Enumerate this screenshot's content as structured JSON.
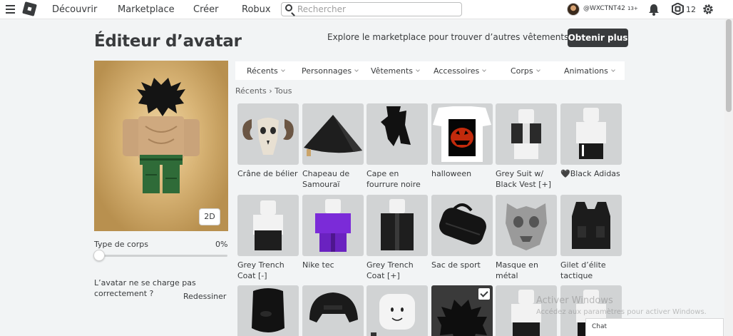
{
  "nav": {
    "discover": "Découvrir",
    "marketplace": "Marketplace",
    "create": "Créer",
    "robux": "Robux",
    "search_placeholder": "Rechercher",
    "username": "@WXCTNT42",
    "age_badge": "13+",
    "robux_balance": "12"
  },
  "header": {
    "title": "Éditeur d’avatar",
    "promo": "Explore le marketplace pour trouver d’autres vêtements !",
    "get_more": "Obtenir plus"
  },
  "preview": {
    "mode_button": "2D",
    "body_type_label": "Type de corps",
    "body_type_value": "0%",
    "body_type_fraction": 0,
    "load_message": "L’avatar ne se charge pas correctement ?",
    "redraw": "Redessiner"
  },
  "tabs": [
    {
      "label": "Récents"
    },
    {
      "label": "Personnages"
    },
    {
      "label": "Vêtements"
    },
    {
      "label": "Accessoires"
    },
    {
      "label": "Corps"
    },
    {
      "label": "Animations"
    }
  ],
  "breadcrumb": {
    "parent": "Récents",
    "separator": "›",
    "current": "Tous"
  },
  "items": [
    {
      "name": "Crâne de bélier",
      "icon": "ram-skull-icon"
    },
    {
      "name": "Chapeau de Samouraï",
      "icon": "samurai-hat-icon"
    },
    {
      "name": "Cape en fourrure noire",
      "icon": "black-fur-cape-icon"
    },
    {
      "name": "halloween",
      "icon": "halloween-shirt-icon"
    },
    {
      "name": "Grey Suit w/ Black Vest [+]",
      "icon": "grey-suit-icon"
    },
    {
      "name": "🖤Black Adidas",
      "icon": "black-adidas-icon"
    },
    {
      "name": "Grey Trench Coat [-]",
      "icon": "grey-trench-coat-icon"
    },
    {
      "name": "Nike tec",
      "icon": "nike-tec-icon"
    },
    {
      "name": "Grey Trench Coat [+]",
      "icon": "grey-trench-coat-icon"
    },
    {
      "name": "Sac de sport",
      "icon": "duffel-bag-icon"
    },
    {
      "name": "Masque en métal",
      "icon": "metal-mask-icon"
    },
    {
      "name": "Gilet d’élite tactique",
      "icon": "tactical-vest-icon"
    },
    {
      "name": "",
      "icon": "black-mask-icon"
    },
    {
      "name": "",
      "icon": "helmet-icon"
    },
    {
      "name": "",
      "icon": "head-icon"
    },
    {
      "name": "",
      "icon": "black-hair-icon",
      "selected": true
    },
    {
      "name": "",
      "icon": "pants-icon"
    },
    {
      "name": "",
      "icon": "outfit-icon"
    }
  ],
  "watermark": {
    "line1": "Activer Windows",
    "line2": "Accédez aux paramètres pour activer Windows."
  },
  "chat": {
    "label": "Chat"
  }
}
